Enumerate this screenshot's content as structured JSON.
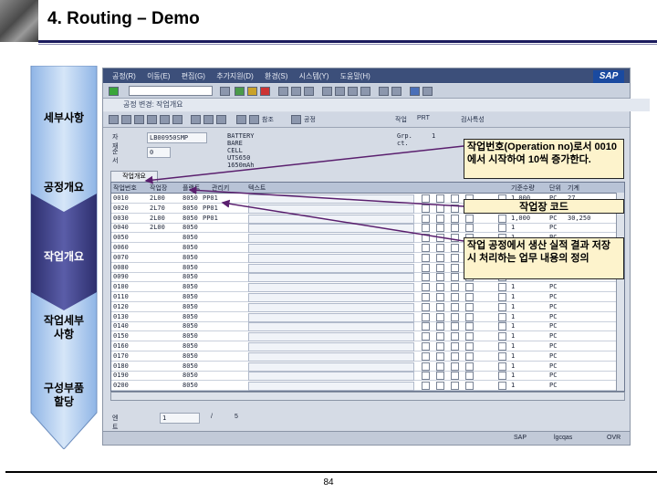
{
  "slide": {
    "title": "4. Routing – Demo",
    "page_number": "84"
  },
  "flow_steps": [
    "세부사항",
    "공정개요",
    "작업개요",
    "작업세부\n사항",
    "구성부품\n할당"
  ],
  "sap": {
    "menu_items": [
      "공정(R)",
      "이동(E)",
      "편집(G)",
      "추가지원(D)",
      "환경(S)",
      "시스템(Y)",
      "도움말(H)"
    ],
    "logo": "SAP",
    "screen_title": "공정 변경: 작업개요",
    "toolbar2_items": [
      "참조",
      "공정",
      "작업",
      "PRT",
      "검사특성"
    ],
    "header": {
      "material_label": "자재",
      "material_value": "LB00950SMP",
      "material_desc": "BATTERY BARE CELL UTS650 1650mAh",
      "grp_label": "Grp. ct.",
      "grp_value": "1",
      "seq_label": "순서",
      "seq_value": "0"
    },
    "tab_label": "작업개요",
    "columns": [
      "작업번호",
      "작업장",
      "플랜트",
      "관리키",
      "텍스트",
      "기준수량",
      "단위",
      "기계"
    ],
    "rows": [
      {
        "op": "0010",
        "wc": "2L00",
        "plant": "8050",
        "ctrl": "PP01",
        "base": "1,000",
        "unit": "PC",
        "m": "27"
      },
      {
        "op": "0020",
        "wc": "2L70",
        "plant": "8050",
        "ctrl": "PP01",
        "base": "1",
        "unit": "PC",
        "m": "6"
      },
      {
        "op": "0030",
        "wc": "2L00",
        "plant": "8050",
        "ctrl": "PP01",
        "base": "1,000",
        "unit": "PC",
        "m": "30,250"
      },
      {
        "op": "0040",
        "wc": "2L00",
        "plant": "8050",
        "ctrl": "",
        "base": "1",
        "unit": "PC",
        "m": ""
      },
      {
        "op": "0050",
        "wc": "",
        "plant": "8050",
        "ctrl": "",
        "base": "1",
        "unit": "PC",
        "m": ""
      },
      {
        "op": "0060",
        "wc": "",
        "plant": "8050",
        "ctrl": "",
        "base": "1",
        "unit": "PC",
        "m": ""
      },
      {
        "op": "0070",
        "wc": "",
        "plant": "8050",
        "ctrl": "",
        "base": "1",
        "unit": "PC",
        "m": ""
      },
      {
        "op": "0080",
        "wc": "",
        "plant": "8050",
        "ctrl": "",
        "base": "1",
        "unit": "PC",
        "m": ""
      },
      {
        "op": "0090",
        "wc": "",
        "plant": "8050",
        "ctrl": "",
        "base": "1",
        "unit": "PC",
        "m": ""
      },
      {
        "op": "0100",
        "wc": "",
        "plant": "8050",
        "ctrl": "",
        "base": "1",
        "unit": "PC",
        "m": ""
      },
      {
        "op": "0110",
        "wc": "",
        "plant": "8050",
        "ctrl": "",
        "base": "1",
        "unit": "PC",
        "m": ""
      },
      {
        "op": "0120",
        "wc": "",
        "plant": "8050",
        "ctrl": "",
        "base": "1",
        "unit": "PC",
        "m": ""
      },
      {
        "op": "0130",
        "wc": "",
        "plant": "8050",
        "ctrl": "",
        "base": "1",
        "unit": "PC",
        "m": ""
      },
      {
        "op": "0140",
        "wc": "",
        "plant": "8050",
        "ctrl": "",
        "base": "1",
        "unit": "PC",
        "m": ""
      },
      {
        "op": "0150",
        "wc": "",
        "plant": "8050",
        "ctrl": "",
        "base": "1",
        "unit": "PC",
        "m": ""
      },
      {
        "op": "0160",
        "wc": "",
        "plant": "8050",
        "ctrl": "",
        "base": "1",
        "unit": "PC",
        "m": ""
      },
      {
        "op": "0170",
        "wc": "",
        "plant": "8050",
        "ctrl": "",
        "base": "1",
        "unit": "PC",
        "m": ""
      },
      {
        "op": "0180",
        "wc": "",
        "plant": "8050",
        "ctrl": "",
        "base": "1",
        "unit": "PC",
        "m": ""
      },
      {
        "op": "0190",
        "wc": "",
        "plant": "8050",
        "ctrl": "",
        "base": "1",
        "unit": "PC",
        "m": ""
      },
      {
        "op": "0200",
        "wc": "",
        "plant": "8050",
        "ctrl": "",
        "base": "1",
        "unit": "PC",
        "m": ""
      }
    ],
    "entry": {
      "label": "엔트리",
      "value": "1",
      "of_label": "/",
      "total": "5"
    },
    "status": {
      "system": "SAP",
      "client": "lgcqas",
      "mode": "OVR"
    }
  },
  "callouts": {
    "c1": "작업번호(Operation no)로서 0010에서 시작하여 10씩 증가한다.",
    "c2": "작업장 코드",
    "c3": "작업 공정에서 생산 실적 결과 저장 시 처리하는 업무 내용의 정의"
  }
}
